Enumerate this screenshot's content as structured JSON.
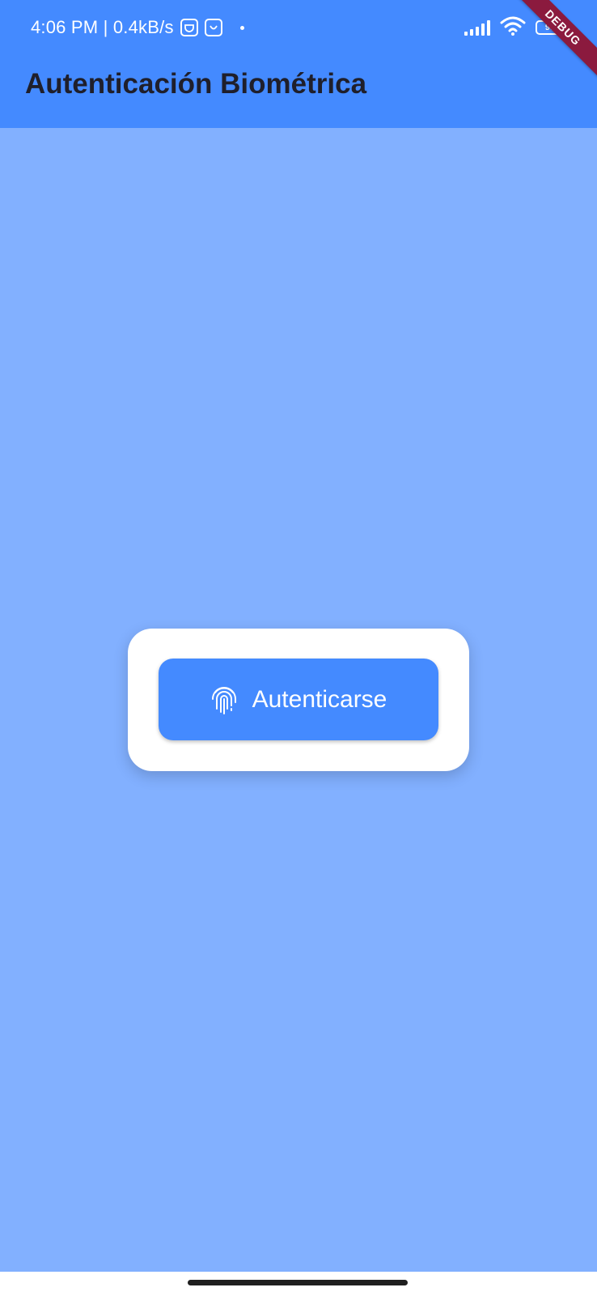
{
  "status_bar": {
    "time_speed": "4:06 PM | 0.4kB/s",
    "battery_level": "99",
    "icons": [
      "pipi-app-icon",
      "smile-app-icon",
      "signal-icon",
      "wifi-icon",
      "battery-icon"
    ]
  },
  "app_bar": {
    "title": "Autenticación Biométrica"
  },
  "debug_banner": {
    "label": "DEBUG"
  },
  "auth": {
    "button_label": "Autenticarse",
    "icon": "fingerprint-icon"
  },
  "colors": {
    "primary": "#448aff",
    "background": "#82b0ff",
    "card": "#ffffff",
    "title_text": "#1f1f2b"
  }
}
